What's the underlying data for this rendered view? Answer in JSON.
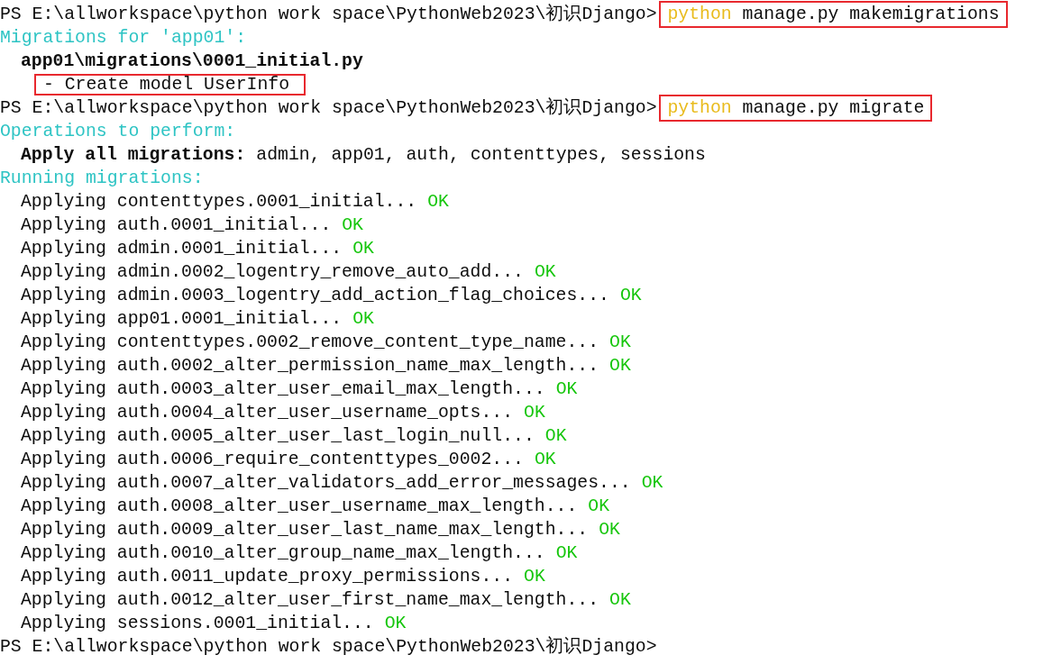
{
  "lines": [
    {
      "kind": "prompt",
      "prompt": "PS E:\\allworkspace\\python work space\\PythonWeb2023\\初识Django>",
      "command_name": "python",
      "command_args": "manage.py makemigrations",
      "highlighted": true
    },
    {
      "kind": "heading",
      "text": "Migrations for 'app01':"
    },
    {
      "kind": "file",
      "text": "app01\\migrations\\0001_initial.py"
    },
    {
      "kind": "note",
      "text": "- Create model UserInfo",
      "highlighted": true
    },
    {
      "kind": "prompt",
      "prompt": "PS E:\\allworkspace\\python work space\\PythonWeb2023\\初识Django>",
      "command_name": "python",
      "command_args": "manage.py migrate",
      "highlighted": true
    },
    {
      "kind": "heading",
      "text": "Operations to perform:"
    },
    {
      "kind": "apply_all",
      "label": "Apply all migrations:",
      "value": "admin, app01, auth, contenttypes, sessions"
    },
    {
      "kind": "heading",
      "text": "Running migrations:"
    },
    {
      "kind": "step",
      "text": "Applying contenttypes.0001_initial...",
      "status": "OK"
    },
    {
      "kind": "step",
      "text": "Applying auth.0001_initial...",
      "status": "OK"
    },
    {
      "kind": "step",
      "text": "Applying admin.0001_initial...",
      "status": "OK"
    },
    {
      "kind": "step",
      "text": "Applying admin.0002_logentry_remove_auto_add...",
      "status": "OK"
    },
    {
      "kind": "step",
      "text": "Applying admin.0003_logentry_add_action_flag_choices...",
      "status": "OK"
    },
    {
      "kind": "step",
      "text": "Applying app01.0001_initial...",
      "status": "OK"
    },
    {
      "kind": "step",
      "text": "Applying contenttypes.0002_remove_content_type_name...",
      "status": "OK"
    },
    {
      "kind": "step",
      "text": "Applying auth.0002_alter_permission_name_max_length...",
      "status": "OK"
    },
    {
      "kind": "step",
      "text": "Applying auth.0003_alter_user_email_max_length...",
      "status": "OK"
    },
    {
      "kind": "step",
      "text": "Applying auth.0004_alter_user_username_opts...",
      "status": "OK"
    },
    {
      "kind": "step",
      "text": "Applying auth.0005_alter_user_last_login_null...",
      "status": "OK"
    },
    {
      "kind": "step",
      "text": "Applying auth.0006_require_contenttypes_0002...",
      "status": "OK"
    },
    {
      "kind": "step",
      "text": "Applying auth.0007_alter_validators_add_error_messages...",
      "status": "OK"
    },
    {
      "kind": "step",
      "text": "Applying auth.0008_alter_user_username_max_length...",
      "status": "OK"
    },
    {
      "kind": "step",
      "text": "Applying auth.0009_alter_user_last_name_max_length...",
      "status": "OK"
    },
    {
      "kind": "step",
      "text": "Applying auth.0010_alter_group_name_max_length...",
      "status": "OK"
    },
    {
      "kind": "step",
      "text": "Applying auth.0011_update_proxy_permissions...",
      "status": "OK"
    },
    {
      "kind": "step",
      "text": "Applying auth.0012_alter_user_first_name_max_length...",
      "status": "OK"
    },
    {
      "kind": "step",
      "text": "Applying sessions.0001_initial...",
      "status": "OK"
    },
    {
      "kind": "prompt",
      "prompt": "PS E:\\allworkspace\\python work space\\PythonWeb2023\\初识Django>"
    }
  ]
}
